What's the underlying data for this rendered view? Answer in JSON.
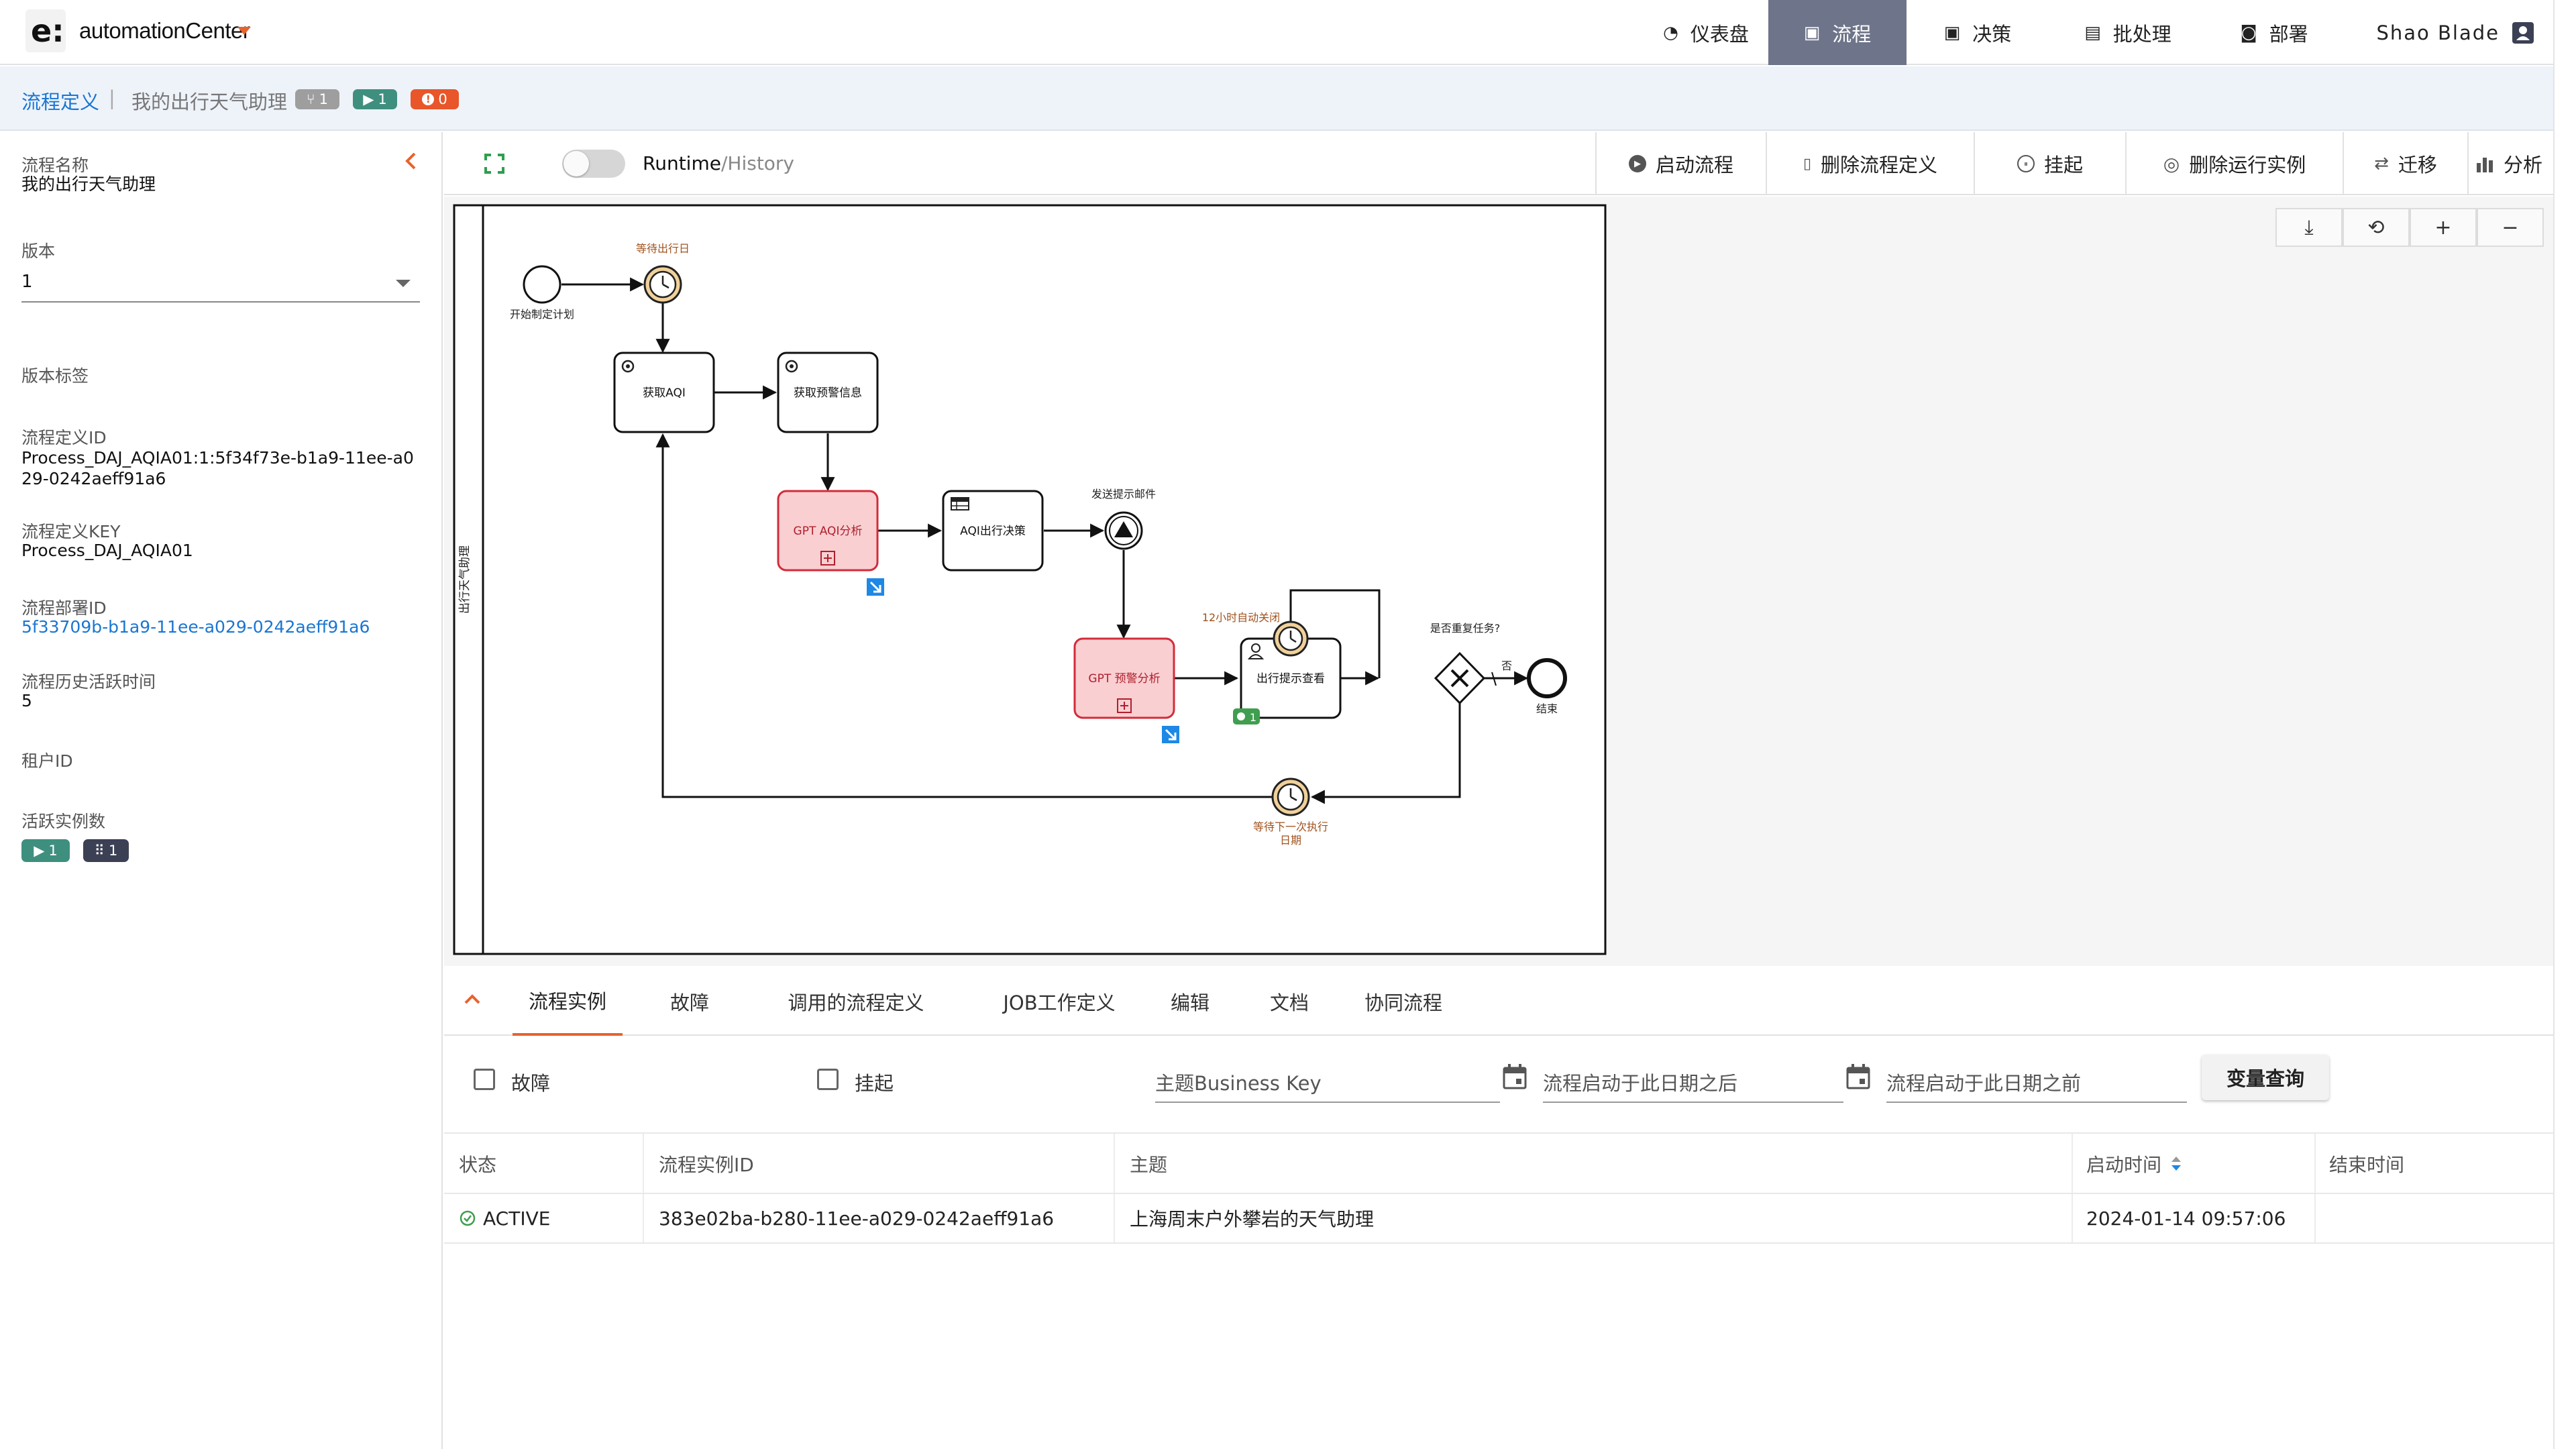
{
  "app": {
    "logo_letter": "e:",
    "title": "automationCenter"
  },
  "nav": [
    {
      "label": "仪表盘",
      "icon": "◔",
      "active": false
    },
    {
      "label": "流程",
      "icon": "▣",
      "active": true
    },
    {
      "label": "决策",
      "icon": "▣",
      "active": false
    },
    {
      "label": "批处理",
      "icon": "▤",
      "active": false
    },
    {
      "label": "部署",
      "icon": "◙",
      "active": false
    }
  ],
  "user": {
    "name": "Shao Blade"
  },
  "breadcrumb": {
    "root": "流程定义",
    "sep": "|",
    "current": "我的出行天气助理",
    "badges": [
      {
        "icon": "⑂",
        "count": "1",
        "color": "#9e9e9e"
      },
      {
        "icon": "▶",
        "count": "1",
        "color": "#3f8f7f"
      },
      {
        "icon": "!",
        "count": "0",
        "color": "#e8562a"
      }
    ]
  },
  "sidebar": {
    "name_label": "流程名称",
    "name_value": "我的出行天气助理",
    "version_label": "版本",
    "version_value": "1",
    "tag_label": "版本标签",
    "def_id_label": "流程定义ID",
    "def_id_value": "Process_DAJ_AQIA01:1:5f34f73e-b1a9-11ee-a029-0242aeff91a6",
    "def_key_label": "流程定义KEY",
    "def_key_value": "Process_DAJ_AQIA01",
    "deploy_id_label": "流程部署ID",
    "deploy_id_value": "5f33709b-b1a9-11ee-a029-0242aeff91a6",
    "history_label": "流程历史活跃时间",
    "history_value": "5",
    "tenant_label": "租户ID",
    "active_label": "活跃实例数",
    "active_badges": [
      {
        "icon": "▶",
        "count": "1",
        "color": "#3f8f7f"
      },
      {
        "icon": "⠿",
        "count": "1",
        "color": "#3c4055"
      }
    ]
  },
  "toolbar": {
    "toggle_on": "Runtime",
    "toggle_sep": "/",
    "toggle_off": "History",
    "buttons": [
      {
        "icon": "▶",
        "label": "启动流程"
      },
      {
        "icon": "▯",
        "label": "删除流程定义"
      },
      {
        "icon": "⏸",
        "label": "挂起"
      },
      {
        "icon": "◎",
        "label": "删除运行实例"
      },
      {
        "icon": "⇄",
        "label": "迁移"
      },
      {
        "icon": "▮",
        "label": "分析"
      }
    ]
  },
  "zoom": [
    "⤓",
    "⟲",
    "+",
    "−"
  ],
  "diagram": {
    "lane": "出行天气助理",
    "start_label": "开始制定计划",
    "timer1_label": "等待出行日",
    "task_get_aqi": "获取AQI",
    "task_get_warn": "获取预警信息",
    "task_gpt_aqi": "GPT AQI分析",
    "task_aqi_decision": "AQI出行决策",
    "signal_label": "发送提示邮件",
    "task_gpt_warn": "GPT 预警分析",
    "boundary_timer_label": "12小时自动关闭",
    "task_user_view": "出行提示查看",
    "gateway_label": "是否重复任务?",
    "no_label": "否",
    "end_label": "结束",
    "timer2_label": "等待下一次执行日期",
    "timer2_line1": "等待下一次执行",
    "timer2_line2": "日期"
  },
  "tabs": [
    {
      "label": "流程实例",
      "active": true
    },
    {
      "label": "故障",
      "active": false
    },
    {
      "label": "调用的流程定义",
      "active": false
    },
    {
      "label": "JOB工作定义",
      "active": false
    },
    {
      "label": "编辑",
      "active": false
    },
    {
      "label": "文档",
      "active": false
    },
    {
      "label": "协同流程",
      "active": false
    }
  ],
  "filters": {
    "fault_label": "故障",
    "suspend_label": "挂起",
    "business_key_placeholder": "主题Business Key",
    "after_placeholder": "流程启动于此日期之后",
    "before_placeholder": "流程启动于此日期之前",
    "query_button": "变量查询"
  },
  "table": {
    "columns": [
      "状态",
      "流程实例ID",
      "主题",
      "启动时间",
      "结束时间"
    ],
    "rows": [
      {
        "status": "ACTIVE",
        "id": "383e02ba-b280-11ee-a029-0242aeff91a6",
        "subject": "上海周末户外攀岩的天气助理",
        "start": "2024-01-14 09:57:06",
        "end": ""
      }
    ]
  }
}
